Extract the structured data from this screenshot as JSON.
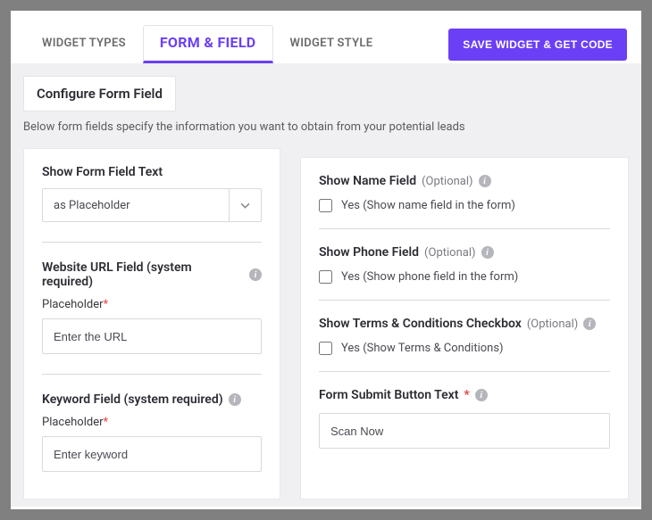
{
  "tabs": {
    "types": "WIDGET TYPES",
    "form": "FORM & FIELD",
    "style": "WIDGET STYLE"
  },
  "save_button": "SAVE WIDGET & GET CODE",
  "configure_title": "Configure Form Field",
  "helper_text": "Below form fields specify the information you want to obtain from your potential leads",
  "left": {
    "show_text": {
      "title": "Show Form Field Text",
      "value": "as Placeholder"
    },
    "url_field": {
      "title": "Website URL Field (system required)",
      "sub": "Placeholder",
      "value": "Enter the URL"
    },
    "keyword_field": {
      "title": "Keyword Field (system required)",
      "sub": "Placeholder",
      "value": "Enter keyword"
    }
  },
  "right": {
    "name_field": {
      "title": "Show Name Field",
      "opt": "(Optional)",
      "check_label": "Yes (Show name field in the form)"
    },
    "phone_field": {
      "title": "Show Phone Field",
      "opt": "(Optional)",
      "check_label": "Yes (Show phone field in the form)"
    },
    "terms_field": {
      "title": "Show Terms & Conditions Checkbox",
      "opt": "(Optional)",
      "check_label": "Yes (Show Terms & Conditions)"
    },
    "submit_field": {
      "title": "Form Submit Button Text",
      "value": "Scan Now"
    }
  }
}
